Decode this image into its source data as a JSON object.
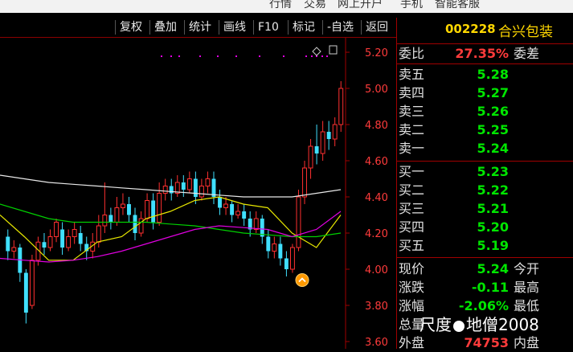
{
  "topbar": {
    "items": [
      "行情",
      "交易",
      "网上开户",
      "手机",
      "智能客服"
    ]
  },
  "toolbar": {
    "buttons": [
      "复权",
      "叠加",
      "统计",
      "画线",
      "F10",
      "标记",
      "-自选",
      "返回"
    ]
  },
  "chart": {
    "price_axis": [
      "5.20",
      "5.00",
      "4.80",
      "4.60",
      "4.40",
      "4.20",
      "4.00",
      "3.80",
      "3.60"
    ],
    "ylim": [
      3.56,
      5.28
    ],
    "candles": [
      [
        4.18,
        4.1,
        4.22,
        4.05
      ],
      [
        4.1,
        4.12,
        4.16,
        4.06
      ],
      [
        4.12,
        3.98,
        4.14,
        3.93
      ],
      [
        3.98,
        3.76,
        4.0,
        3.7
      ],
      [
        3.8,
        4.05,
        4.08,
        3.78
      ],
      [
        4.05,
        4.15,
        4.18,
        4.02
      ],
      [
        4.15,
        4.12,
        4.2,
        4.08
      ],
      [
        4.12,
        4.18,
        4.22,
        4.1
      ],
      [
        4.18,
        4.26,
        4.28,
        4.15
      ],
      [
        4.22,
        4.12,
        4.26,
        4.08
      ],
      [
        4.12,
        4.18,
        4.22,
        4.1
      ],
      [
        4.18,
        4.22,
        4.26,
        4.14
      ],
      [
        4.2,
        4.14,
        4.24,
        4.1
      ],
      [
        4.14,
        4.1,
        4.18,
        4.05
      ],
      [
        4.1,
        4.15,
        4.2,
        4.06
      ],
      [
        4.15,
        4.24,
        4.3,
        4.12
      ],
      [
        4.24,
        4.3,
        4.48,
        4.2
      ],
      [
        4.3,
        4.26,
        4.34,
        4.22
      ],
      [
        4.26,
        4.34,
        4.4,
        4.24
      ],
      [
        4.34,
        4.36,
        4.42,
        4.3
      ],
      [
        4.36,
        4.3,
        4.4,
        4.26
      ],
      [
        4.3,
        4.2,
        4.34,
        4.16
      ],
      [
        4.2,
        4.28,
        4.32,
        4.18
      ],
      [
        4.28,
        4.38,
        4.42,
        4.26
      ],
      [
        4.38,
        4.26,
        4.42,
        4.22
      ],
      [
        4.26,
        4.42,
        4.48,
        4.24
      ],
      [
        4.42,
        4.46,
        4.5,
        4.38
      ],
      [
        4.46,
        4.42,
        4.5,
        4.38
      ],
      [
        4.42,
        4.48,
        4.52,
        4.4
      ],
      [
        4.48,
        4.44,
        4.52,
        4.4
      ],
      [
        4.44,
        4.5,
        4.54,
        4.42
      ],
      [
        4.5,
        4.4,
        4.54,
        4.36
      ],
      [
        4.4,
        4.46,
        4.5,
        4.38
      ],
      [
        4.46,
        4.5,
        4.54,
        4.42
      ],
      [
        4.5,
        4.4,
        4.54,
        4.36
      ],
      [
        4.4,
        4.34,
        4.44,
        4.3
      ],
      [
        4.34,
        4.36,
        4.4,
        4.3
      ],
      [
        4.36,
        4.3,
        4.38,
        4.26
      ],
      [
        4.3,
        4.32,
        4.36,
        4.28
      ],
      [
        4.32,
        4.28,
        4.36,
        4.24
      ],
      [
        4.28,
        4.22,
        4.32,
        4.18
      ],
      [
        4.22,
        4.28,
        4.32,
        4.2
      ],
      [
        4.28,
        4.18,
        4.3,
        4.14
      ],
      [
        4.18,
        4.1,
        4.22,
        4.06
      ],
      [
        4.1,
        4.14,
        4.18,
        4.06
      ],
      [
        4.14,
        4.06,
        4.18,
        4.02
      ],
      [
        4.06,
        4.0,
        4.1,
        3.96
      ],
      [
        4.0,
        4.12,
        4.14,
        3.98
      ],
      [
        4.12,
        4.4,
        4.44,
        4.1
      ],
      [
        4.4,
        4.56,
        4.6,
        4.36
      ],
      [
        4.56,
        4.68,
        4.72,
        4.5
      ],
      [
        4.68,
        4.64,
        4.8,
        4.58
      ],
      [
        4.64,
        4.76,
        4.82,
        4.6
      ],
      [
        4.76,
        4.72,
        4.82,
        4.66
      ],
      [
        4.72,
        4.8,
        4.84,
        4.68
      ],
      [
        4.8,
        5.0,
        5.04,
        4.76
      ]
    ],
    "mas": [
      {
        "color": "#e8e8e8",
        "values": [
          4.52,
          4.5,
          4.48,
          4.47,
          4.46,
          4.45,
          4.44,
          4.43,
          4.42,
          4.41,
          4.4,
          4.4,
          4.4,
          4.42,
          4.44
        ]
      },
      {
        "color": "#e8e800",
        "values": [
          4.3,
          4.18,
          4.05,
          4.05,
          4.15,
          4.18,
          4.28,
          4.32,
          4.38,
          4.4,
          4.36,
          4.34,
          4.2,
          4.12,
          4.3
        ]
      },
      {
        "color": "#00d000",
        "values": [
          4.36,
          4.32,
          4.28,
          4.26,
          4.26,
          4.26,
          4.26,
          4.25,
          4.24,
          4.22,
          4.2,
          4.19,
          4.18,
          4.18,
          4.2
        ]
      },
      {
        "color": "#e000e0",
        "values": [
          4.06,
          4.05,
          4.04,
          4.05,
          4.07,
          4.1,
          4.14,
          4.18,
          4.22,
          4.24,
          4.23,
          4.22,
          4.18,
          4.22,
          4.32
        ]
      }
    ]
  },
  "stock": {
    "code": "002228",
    "name": "合兴包装",
    "weibi_label": "委比",
    "weibi_value": "27.35%",
    "weicha_label": "委差",
    "sell": [
      {
        "label": "卖五",
        "price": "5.28"
      },
      {
        "label": "卖四",
        "price": "5.27"
      },
      {
        "label": "卖三",
        "price": "5.26"
      },
      {
        "label": "卖二",
        "price": "5.25"
      },
      {
        "label": "卖一",
        "price": "5.24"
      }
    ],
    "buy": [
      {
        "label": "买一",
        "price": "5.23"
      },
      {
        "label": "买二",
        "price": "5.22"
      },
      {
        "label": "买三",
        "price": "5.21"
      },
      {
        "label": "买四",
        "price": "5.20"
      },
      {
        "label": "买五",
        "price": "5.19"
      }
    ],
    "stats": [
      {
        "label": "现价",
        "value": "5.24",
        "tail": "今开"
      },
      {
        "label": "涨跌",
        "value": "-0.11",
        "tail": "最高"
      },
      {
        "label": "涨幅",
        "value": "-2.06%",
        "tail": "最低"
      },
      {
        "label": "总量",
        "value": "",
        "tail": ""
      },
      {
        "label": "外盘",
        "value": "74753",
        "tail": "内盘"
      }
    ]
  },
  "watermark": {
    "text1": "尺度",
    "text2": "地僧2008"
  }
}
